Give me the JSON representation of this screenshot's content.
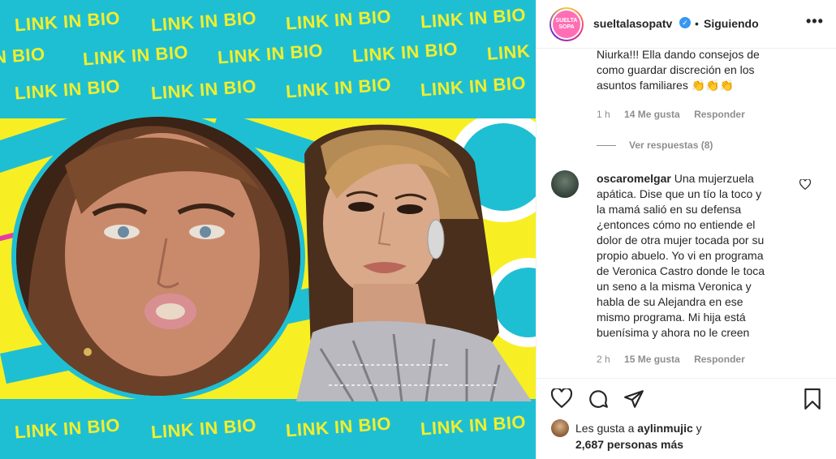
{
  "media": {
    "banner_text": "LINK IN BIO",
    "banner_partial": "N BIO",
    "colors": {
      "cyan": "#1fbfd3",
      "yellow": "#f7ef24",
      "banner_text": "#f2ee2c",
      "pink_stripe": "#e63ca8"
    }
  },
  "header": {
    "username": "sueltalasopatv",
    "separator": "•",
    "follow_status": "Siguiendo",
    "more_icon": "more-horizontal-icon",
    "avatar_line1": "SUELTA",
    "avatar_line2": "SOPA"
  },
  "comments": {
    "first": {
      "text_lines": [
        "Niurka!!! Ella dando consejos de",
        "como guardar discreción en los",
        "asuntos familiares 👏👏👏"
      ],
      "time": "1 h",
      "likes": "14 Me gusta",
      "reply": "Responder"
    },
    "view_replies": "Ver respuestas (8)",
    "second": {
      "username": "oscaromelgar",
      "text_first": "Una mujerzuela",
      "text_lines": [
        "apática. Dise que un tío la toco y",
        "la mamá salió en su defensa",
        "¿entonces cómo no entiende el",
        "dolor de otra mujer tocada por su",
        "propio abuelo. Yo vi en programa",
        "de Veronica Castro donde le toca",
        "un seno a la misma Veronica y",
        "habla de su Alejandra en ese",
        "mismo programa. Mi hija está",
        "buenísima y ahora no le creen"
      ],
      "time": "2 h",
      "likes": "15 Me gusta",
      "reply": "Responder"
    }
  },
  "actions": {
    "icons": [
      "heart-icon",
      "comment-icon",
      "share-icon",
      "bookmark-icon"
    ],
    "likes_prefix": "Les gusta a",
    "likes_user": "aylinmujic",
    "likes_suffix": "y",
    "likes_others": "2,687 personas más"
  }
}
